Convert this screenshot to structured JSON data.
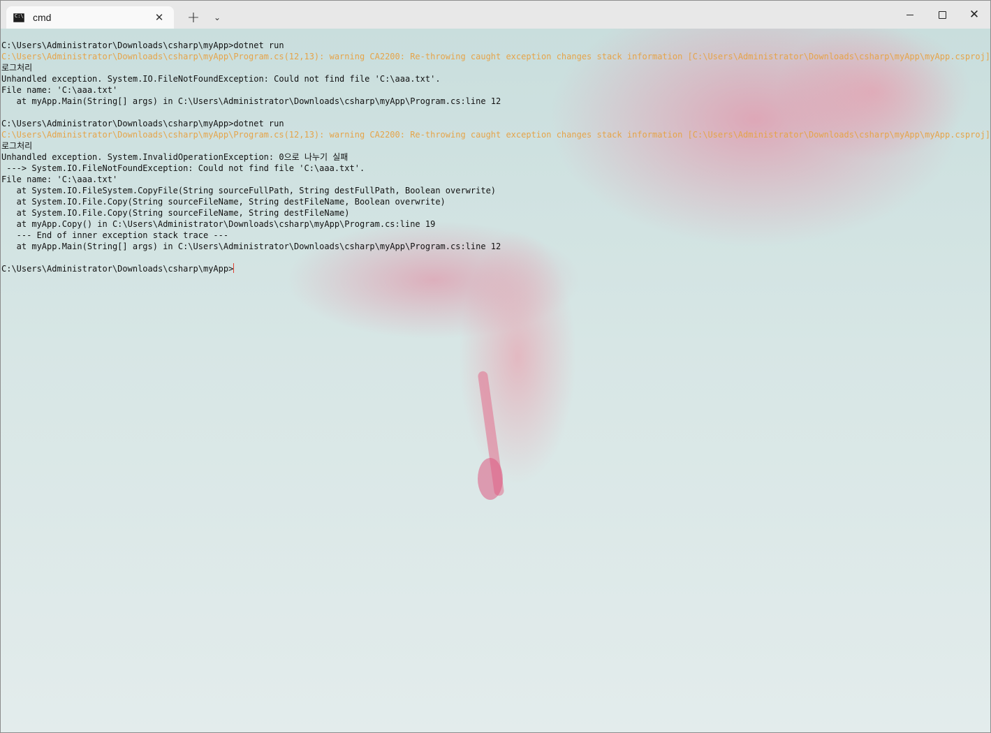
{
  "tab": {
    "title": "cmd",
    "close_glyph": "✕"
  },
  "toolbar": {
    "new_tab_glyph": "+",
    "dropdown_glyph": "⌄"
  },
  "caption": {
    "close_glyph": "✕"
  },
  "colors": {
    "warning_text": "#e5a44a",
    "normal_text": "#111111",
    "cursor": "#e04030"
  },
  "terminal": {
    "lines": [
      {
        "text": "C:\\Users\\Administrator\\Downloads\\csharp\\myApp>dotnet run",
        "kind": "normal"
      },
      {
        "text": "C:\\Users\\Administrator\\Downloads\\csharp\\myApp\\Program.cs(12,13): warning CA2200: Re-throwing caught exception changes stack information [C:\\Users\\Administrator\\Downloads\\csharp\\myApp\\myApp.csproj]",
        "kind": "warn"
      },
      {
        "text": "로그처리",
        "kind": "normal"
      },
      {
        "text": "Unhandled exception. System.IO.FileNotFoundException: Could not find file 'C:\\aaa.txt'.",
        "kind": "normal"
      },
      {
        "text": "File name: 'C:\\aaa.txt'",
        "kind": "normal"
      },
      {
        "text": "   at myApp.Main(String[] args) in C:\\Users\\Administrator\\Downloads\\csharp\\myApp\\Program.cs:line 12",
        "kind": "normal"
      },
      {
        "text": "",
        "kind": "normal"
      },
      {
        "text": "C:\\Users\\Administrator\\Downloads\\csharp\\myApp>dotnet run",
        "kind": "normal"
      },
      {
        "text": "C:\\Users\\Administrator\\Downloads\\csharp\\myApp\\Program.cs(12,13): warning CA2200: Re-throwing caught exception changes stack information [C:\\Users\\Administrator\\Downloads\\csharp\\myApp\\myApp.csproj]",
        "kind": "warn"
      },
      {
        "text": "로그처리",
        "kind": "normal"
      },
      {
        "text": "Unhandled exception. System.InvalidOperationException: 0으로 나누기 실패",
        "kind": "normal"
      },
      {
        "text": " ---> System.IO.FileNotFoundException: Could not find file 'C:\\aaa.txt'.",
        "kind": "normal"
      },
      {
        "text": "File name: 'C:\\aaa.txt'",
        "kind": "normal"
      },
      {
        "text": "   at System.IO.FileSystem.CopyFile(String sourceFullPath, String destFullPath, Boolean overwrite)",
        "kind": "normal"
      },
      {
        "text": "   at System.IO.File.Copy(String sourceFileName, String destFileName, Boolean overwrite)",
        "kind": "normal"
      },
      {
        "text": "   at System.IO.File.Copy(String sourceFileName, String destFileName)",
        "kind": "normal"
      },
      {
        "text": "   at myApp.Copy() in C:\\Users\\Administrator\\Downloads\\csharp\\myApp\\Program.cs:line 19",
        "kind": "normal"
      },
      {
        "text": "   --- End of inner exception stack trace ---",
        "kind": "normal"
      },
      {
        "text": "   at myApp.Main(String[] args) in C:\\Users\\Administrator\\Downloads\\csharp\\myApp\\Program.cs:line 12",
        "kind": "normal"
      },
      {
        "text": "",
        "kind": "normal"
      }
    ],
    "prompt": "C:\\Users\\Administrator\\Downloads\\csharp\\myApp>"
  }
}
